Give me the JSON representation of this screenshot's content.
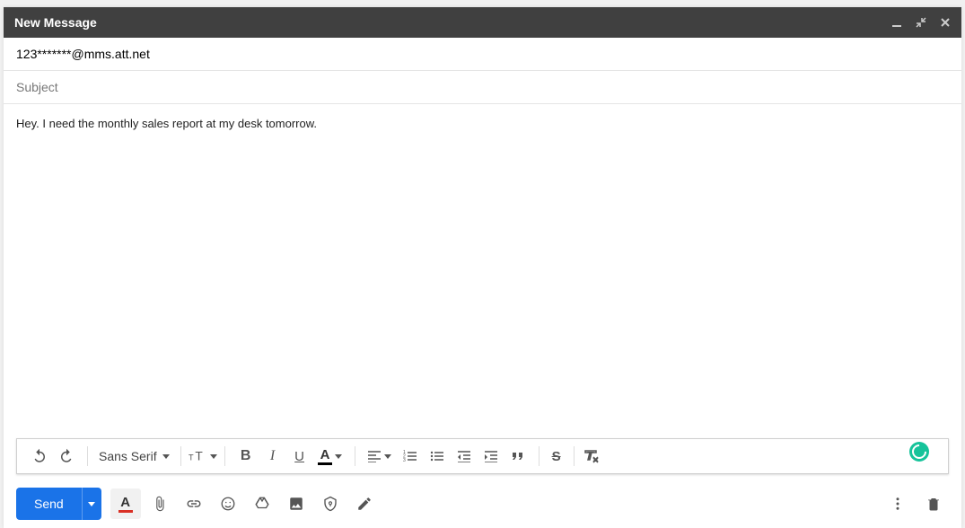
{
  "window": {
    "title": "New Message"
  },
  "to": {
    "value": "123*******@mms.att.net"
  },
  "subject": {
    "placeholder": "Subject",
    "value": ""
  },
  "body": {
    "text": "Hey. I need the monthly sales report at my desk tomorrow."
  },
  "format": {
    "font": "Sans Serif"
  },
  "send": {
    "label": "Send"
  }
}
